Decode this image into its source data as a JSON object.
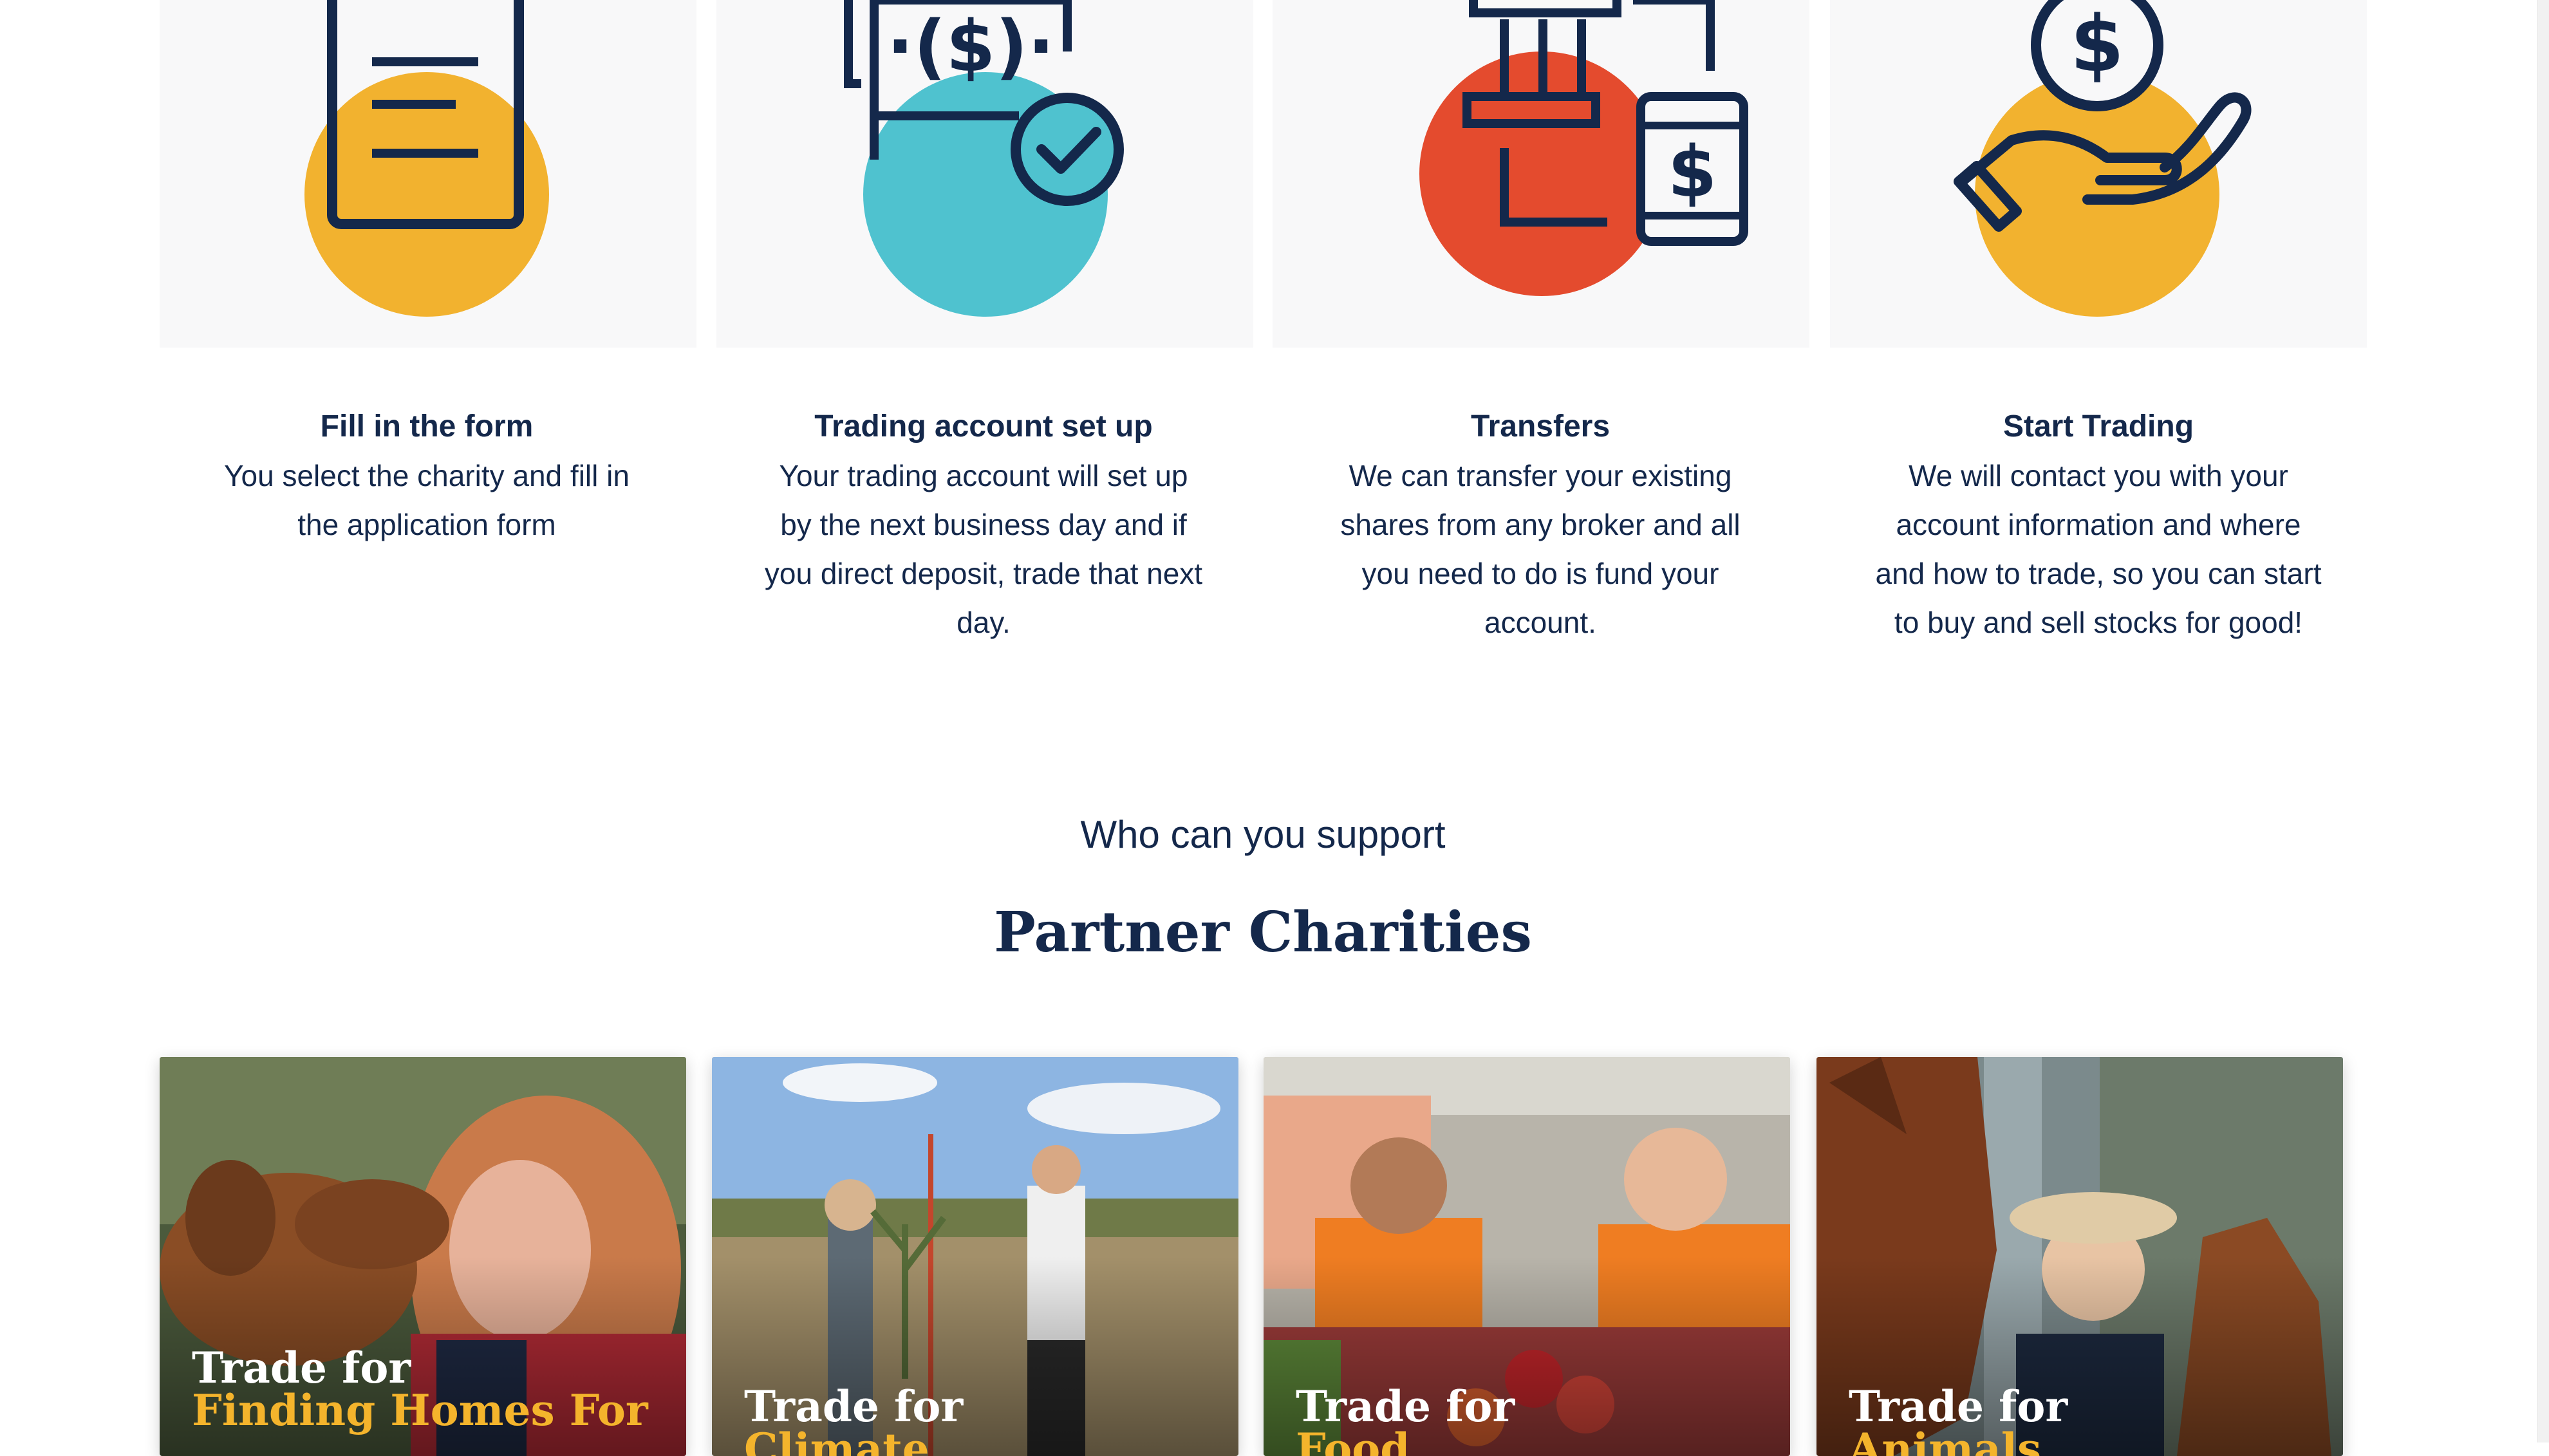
{
  "steps": [
    {
      "title": "Fill in the form",
      "icon": "form-document-icon",
      "circle_color": "#f2b22f",
      "desc_lines": [
        "You select the charity and fill in",
        "the application form"
      ]
    },
    {
      "title": "Trading account set up",
      "icon": "money-check-icon",
      "circle_color": "#4fc2cf",
      "desc_lines": [
        "Your trading account will set up",
        "by the next business day and if",
        "you direct deposit, trade that next",
        "day."
      ]
    },
    {
      "title": "Transfers",
      "icon": "bank-transfer-icon",
      "circle_color": "#e44b2e",
      "desc_lines": [
        "We can transfer your existing",
        "shares from any broker and all",
        "you need to do is fund your",
        "account."
      ]
    },
    {
      "title": "Start Trading",
      "icon": "hand-coin-icon",
      "circle_color": "#f2b22f",
      "desc_lines": [
        "We will contact you with your",
        "account information and where",
        "and how to trade, so you can start",
        "to buy and sell stocks for good!"
      ]
    }
  ],
  "section": {
    "eyebrow": "Who can you support",
    "title": "Partner Charities"
  },
  "charity_cards": [
    {
      "prefix": "Trade for",
      "cause": "Finding Homes For",
      "photo": "woman-with-dog-photo"
    },
    {
      "prefix": "Trade for",
      "cause": "Climate",
      "photo": "tree-planting-photo"
    },
    {
      "prefix": "Trade for",
      "cause": "Food",
      "photo": "food-bank-volunteers-photo"
    },
    {
      "prefix": "Trade for",
      "cause": "Animals",
      "photo": "horses-and-rider-photo"
    }
  ],
  "colors": {
    "navy": "#14284b",
    "accent_yellow": "#f4b42c",
    "tile_bg": "#f8f8f9"
  }
}
